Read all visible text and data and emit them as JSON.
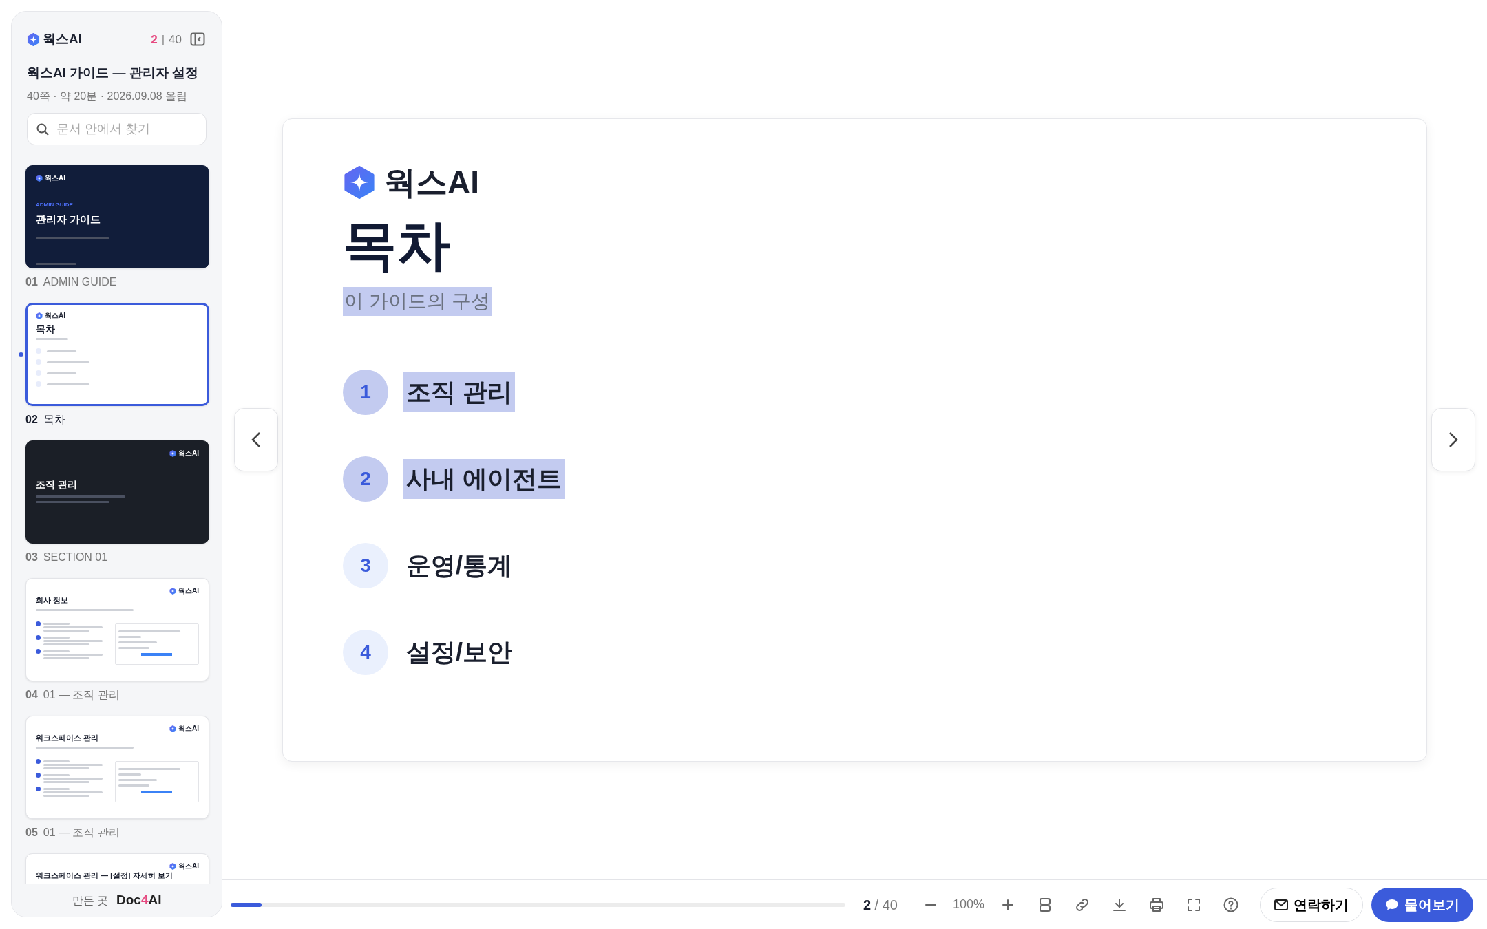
{
  "sidebar": {
    "logo": "웍스AI",
    "page_current": "2",
    "counter_separator": "|",
    "page_total": "40",
    "doc_title": "웍스AI 가이드 — 관리자 설정",
    "meta": "40쪽 · 약 20분 · 2026.09.08 올림",
    "search": {
      "placeholder": "문서 안에서 찾기"
    },
    "pages": [
      {
        "number": "01",
        "label": "ADMIN GUIDE",
        "selected": false,
        "thumb": {
          "kind": "cover",
          "logo": "웍스AI",
          "eyebrow": "ADMIN GUIDE",
          "title": "관리자 가이드"
        }
      },
      {
        "number": "02",
        "label": "목차",
        "selected": true,
        "thumb": {
          "kind": "toc",
          "logo": "웍스AI",
          "title": "목차"
        }
      },
      {
        "number": "03",
        "label": "SECTION 01",
        "selected": false,
        "thumb": {
          "kind": "section",
          "logo": "웍스AI",
          "title": "조직 관리"
        }
      },
      {
        "number": "04",
        "label": "01 — 조직 관리",
        "selected": false,
        "thumb": {
          "kind": "content",
          "logo": "웍스AI",
          "title": "회사 정보"
        }
      },
      {
        "number": "05",
        "label": "01 — 조직 관리",
        "selected": false,
        "thumb": {
          "kind": "content",
          "logo": "웍스AI",
          "title": "워크스페이스 관리"
        }
      },
      {
        "thumb": {
          "kind": "content_top",
          "logo": "웍스AI",
          "title": "워크스페이스 관리 — [설정] 자세히 보기"
        }
      }
    ],
    "footer": {
      "prefix": "만든 곳",
      "brand": "Doc",
      "brand_accent": "4",
      "brand_tail": "AI"
    }
  },
  "slide": {
    "logo": "웍스AI",
    "title": "목차",
    "subtitle": {
      "text": "이 가이드의 구성",
      "highlighted": true
    },
    "items": [
      {
        "number": "1",
        "title": "조직 관리",
        "highlighted": true
      },
      {
        "number": "2",
        "title": "사내 에이전트",
        "highlighted": true
      },
      {
        "number": "3",
        "title": "운영/통계",
        "highlighted": false
      },
      {
        "number": "4",
        "title": "설정/보안",
        "highlighted": false
      }
    ]
  },
  "toolbar": {
    "progress": {
      "level": 0.05
    },
    "page_current": "2",
    "separator": "/",
    "page_total": "40",
    "zoom": "100%",
    "contact_button": "연락하기",
    "ask_button": "물어보기"
  }
}
